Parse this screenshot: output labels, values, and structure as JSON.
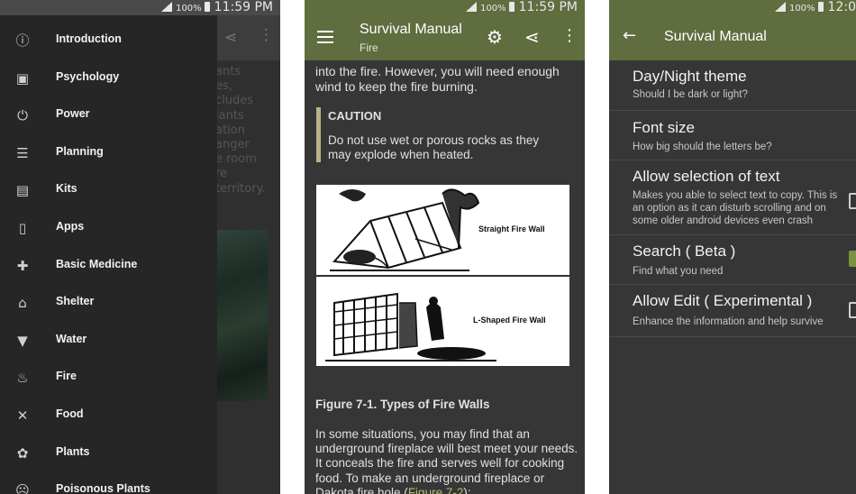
{
  "status": {
    "battery": "100%",
    "time": "11:59 PM",
    "time_short": "12:0"
  },
  "drawer": {
    "items": [
      {
        "label": "Introduction",
        "icon": "info-icon",
        "glyph": "ⓘ"
      },
      {
        "label": "Psychology",
        "icon": "portrait-icon",
        "glyph": "▣"
      },
      {
        "label": "Power",
        "icon": "plug-icon",
        "glyph": "⏻"
      },
      {
        "label": "Planning",
        "icon": "list-icon",
        "glyph": "☰"
      },
      {
        "label": "Kits",
        "icon": "briefcase-icon",
        "glyph": "▤"
      },
      {
        "label": "Apps",
        "icon": "phone-icon",
        "glyph": "▯"
      },
      {
        "label": "Basic Medicine",
        "icon": "bandage-icon",
        "glyph": "✚"
      },
      {
        "label": "Shelter",
        "icon": "store-icon",
        "glyph": "⌂"
      },
      {
        "label": "Water",
        "icon": "cup-icon",
        "glyph": "▼"
      },
      {
        "label": "Fire",
        "icon": "flame-icon",
        "glyph": "♨"
      },
      {
        "label": "Food",
        "icon": "utensils-icon",
        "glyph": "✕"
      },
      {
        "label": "Plants",
        "icon": "flower-icon",
        "glyph": "✿"
      },
      {
        "label": "Poisonous Plants",
        "icon": "sad-face-icon",
        "glyph": "☹"
      }
    ],
    "behind_text": "ants\nes,\ncludes\nlants\nation\nanger\ne room\nre\nterritory."
  },
  "reader": {
    "title": "Survival Manual",
    "subtitle": "Fire",
    "para1": "into the fire. However, you will need enough wind to keep the fire burning.",
    "caution_head": "CAUTION",
    "caution_body": "Do not use wet or porous rocks as they may explode when heated.",
    "fig_label_1": "Straight Fire Wall",
    "fig_label_2": "L-Shaped Fire Wall",
    "figure_caption": "Figure 7-1. Types of Fire Walls",
    "para2": "In some situations, you may find that an underground fireplace will best meet your needs. It conceals the fire and serves well for cooking food. To make an underground fireplace or Dakota fire hole (",
    "para2_link": "Figure 7-2",
    "para2_end": "):"
  },
  "settings": {
    "title": "Survival Manual",
    "rows": [
      {
        "title": "Day/Night theme",
        "sub": "Should I be dark or light?",
        "checkbox": "none"
      },
      {
        "title": "Font size",
        "sub": "How big should the letters be?",
        "checkbox": "none"
      },
      {
        "title": "Allow selection of text",
        "sub": "Makes you able to select text to copy. This is an option as it can disturb scrolling and on some older android devices even crash",
        "checkbox": "off"
      },
      {
        "title": "Search ( Beta )",
        "sub": "Find what you need",
        "checkbox": "on"
      },
      {
        "title": "Allow Edit ( Experimental )",
        "sub": "Enhance the information and help survive",
        "checkbox": "off"
      }
    ]
  }
}
